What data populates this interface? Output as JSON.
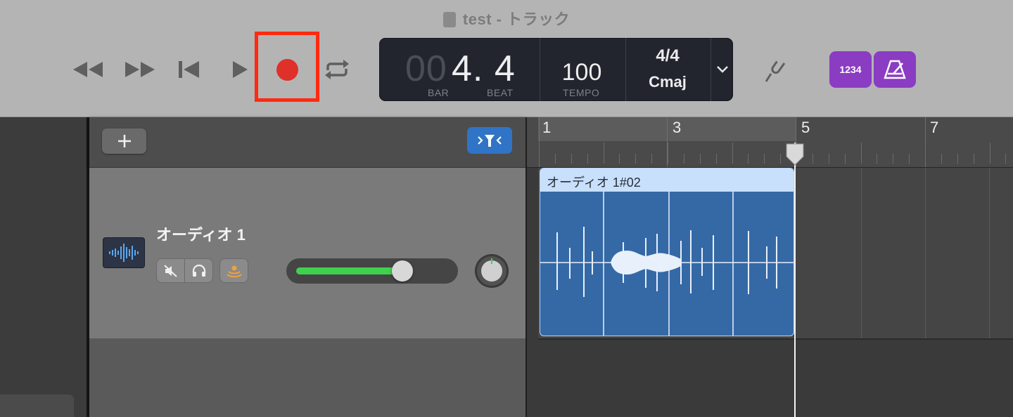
{
  "window": {
    "title": "test - トラック"
  },
  "transport": {
    "rewind_icon": "rewind-icon",
    "fast_forward_icon": "fast-forward-icon",
    "go_to_start_icon": "go-to-start-icon",
    "play_icon": "play-icon",
    "record_icon": "record-icon",
    "cycle_icon": "cycle-icon",
    "record_color": "#e0302a",
    "highlight_color": "#ff2a10"
  },
  "lcd": {
    "position_dim": "00",
    "position": "4. 4",
    "bar_label": "BAR",
    "beat_label": "BEAT",
    "tempo": "100",
    "tempo_label": "TEMPO",
    "time_signature": "4/4",
    "key": "Cmaj"
  },
  "toolbar_right": {
    "tuner_icon": "tuning-fork-icon",
    "count_in_label": "1234",
    "metronome_icon": "metronome-icon",
    "accent_color": "#8a3cc2"
  },
  "track_header": {
    "add_icon": "plus-icon",
    "filter_icon": "filter-icon"
  },
  "track": {
    "name": "オーディオ 1",
    "icon": "audio-waveform-icon",
    "mute_icon": "mute-icon",
    "solo_icon": "headphones-icon",
    "monitor_icon": "input-monitoring-icon",
    "volume_fraction": 0.7,
    "volume_color": "#3fd04e"
  },
  "ruler": {
    "bars": [
      "1",
      "3",
      "5",
      "7"
    ]
  },
  "region": {
    "name": "オーディオ 1#02",
    "color": "#3569a6"
  }
}
